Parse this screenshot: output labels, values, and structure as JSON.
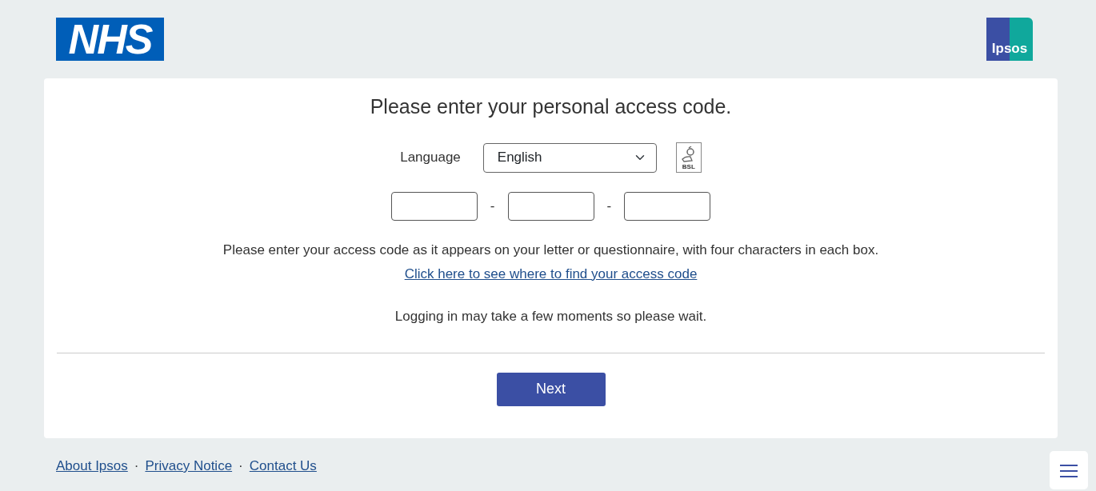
{
  "header": {
    "nhs_logo": "NHS",
    "ipsos_logo": "Ipsos"
  },
  "heading": "Please enter your personal access code.",
  "language": {
    "label": "Language",
    "value": "English",
    "bsl_icon": "BSL"
  },
  "access_code": {
    "boxes": [
      {
        "kind": "field"
      },
      {
        "kind": "field"
      },
      {
        "kind": "field"
      }
    ],
    "separators": [
      "-",
      "-"
    ]
  },
  "instructions": "Please enter your access code as it appears on your letter or questionnaire, with four characters in each box.",
  "help_link": "Click here to see where to find your access code",
  "wait_note": "Logging in may take a few moments so please wait.",
  "next_button": "Next",
  "footer": [
    {
      "kind": "link",
      "text": "About Ipsos"
    },
    {
      "kind": "separator",
      "text": "·"
    },
    {
      "kind": "link",
      "text": "Privacy Notice"
    },
    {
      "kind": "separator",
      "text": "·"
    },
    {
      "kind": "link",
      "text": "Contact Us"
    }
  ]
}
